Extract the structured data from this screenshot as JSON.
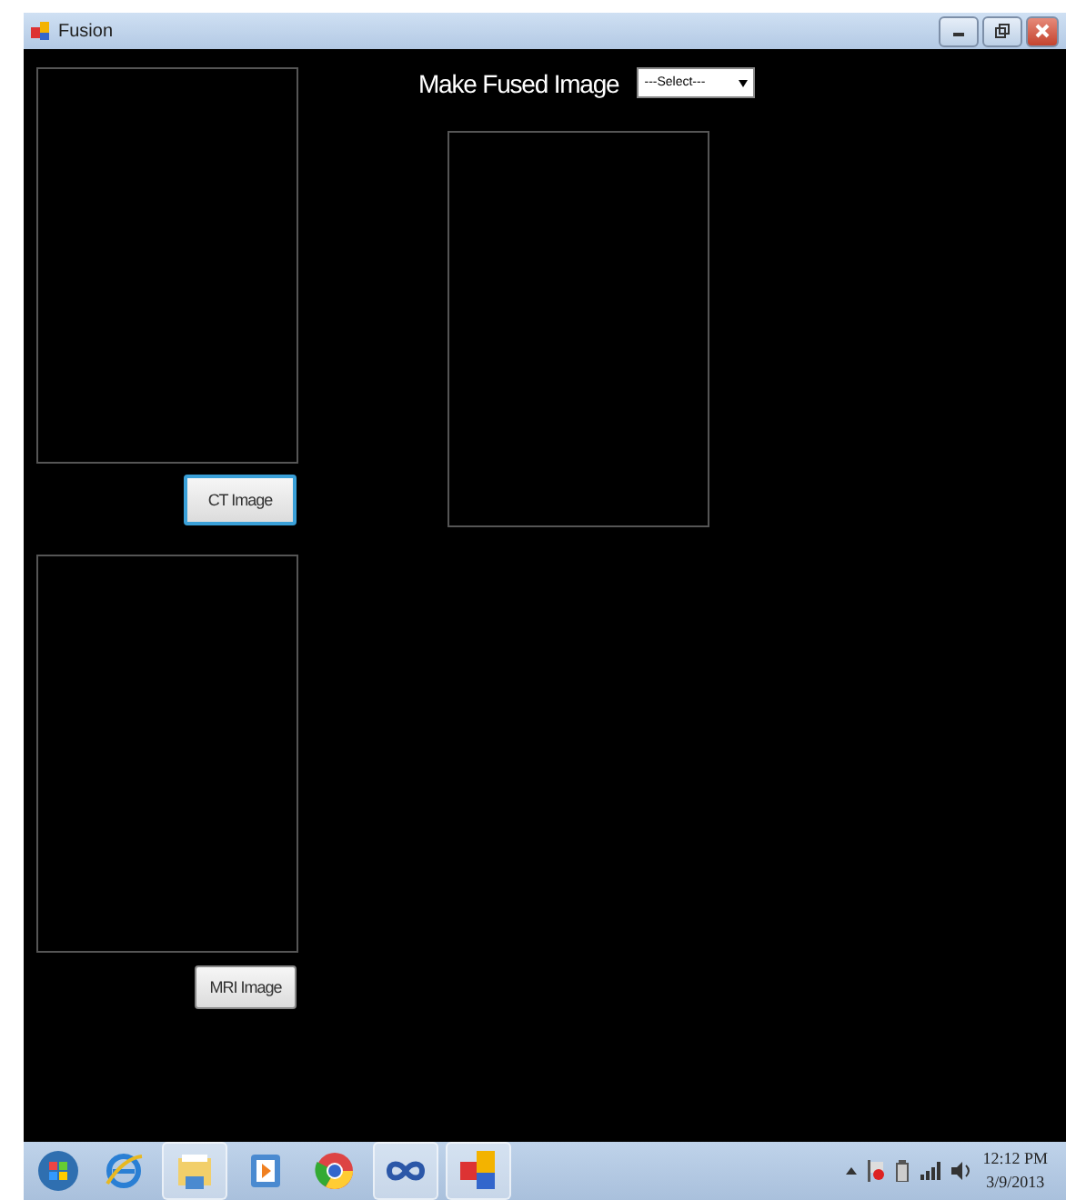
{
  "window": {
    "title": "Fusion"
  },
  "fuse": {
    "label": "Make Fused Image",
    "dropdown": {
      "value": "---Select---"
    }
  },
  "buttons": [
    {
      "label": "CT Image",
      "focused": true
    },
    {
      "label": "MRI Image",
      "focused": false
    }
  ],
  "taskbar": {
    "clock": {
      "time": "12:12 PM",
      "date": "3/9/2013"
    }
  }
}
